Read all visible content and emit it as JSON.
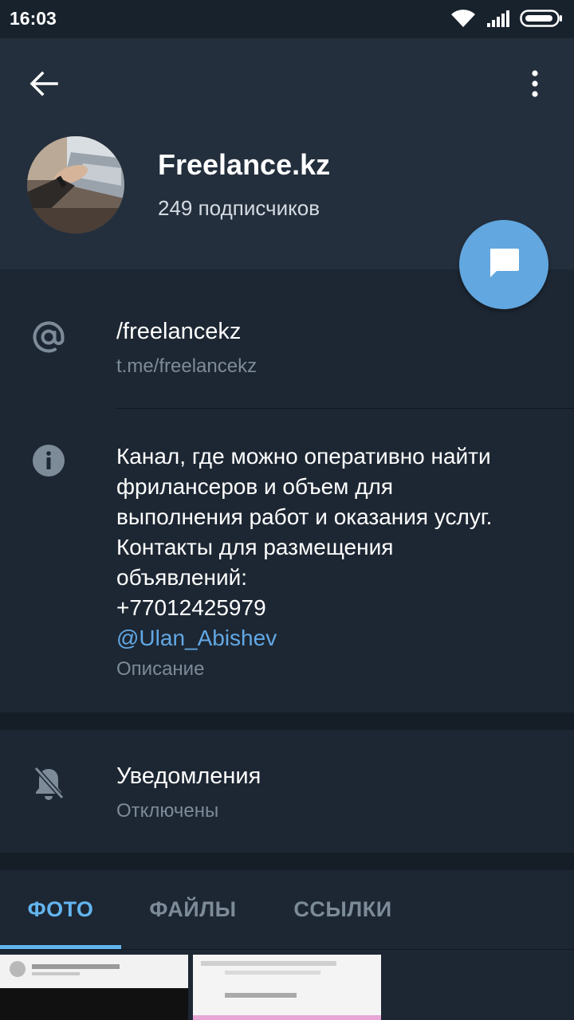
{
  "status_bar": {
    "time": "16:03",
    "icons": [
      "wifi-icon",
      "signal-icon",
      "battery-icon"
    ]
  },
  "header": {
    "back_icon": "arrow-left-icon",
    "menu_icon": "more-vertical-icon",
    "title": "Freelance.kz",
    "subtitle": "249 подписчиков",
    "fab_icon": "message-icon"
  },
  "info": {
    "link": {
      "icon": "at-icon",
      "title": "/freelancekz",
      "subtitle": "t.me/freelancekz"
    },
    "description": {
      "icon": "info-icon",
      "lines": [
        "Канал, где можно оперативно найти",
        "фрилансеров и объем для",
        "выполнения работ и оказания услуг.",
        "Контакты для размещения",
        "объявлений:",
        "+77012425979"
      ],
      "mention": "@Ulan_Abishev",
      "caption": "Описание"
    }
  },
  "notifications": {
    "icon": "bell-off-icon",
    "title": "Уведомления",
    "subtitle": "Отключены"
  },
  "tabs": [
    {
      "label": "ФОТО",
      "active": true
    },
    {
      "label": "ФАЙЛЫ",
      "active": false
    },
    {
      "label": "ССЫЛКИ",
      "active": false
    }
  ],
  "colors": {
    "accent": "#62a7df",
    "header_bg": "#242f3d",
    "body_bg": "#1d2733",
    "link": "#62a8e5"
  }
}
